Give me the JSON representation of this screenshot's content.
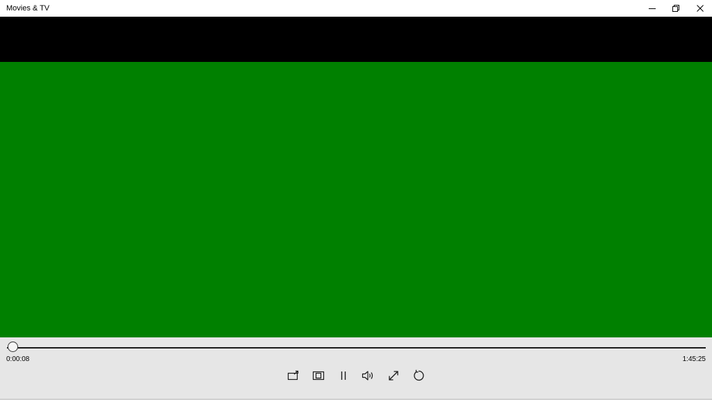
{
  "window": {
    "title": "Movies & TV",
    "buttons": {
      "minimize_icon": "minimize-icon",
      "restore_icon": "restore-icon",
      "close_icon": "close-icon"
    }
  },
  "player": {
    "letterbox_color": "#000000",
    "video_color": "#008000",
    "state": "playing",
    "progress_fraction": 0.0013,
    "time_elapsed": "0:00:08",
    "time_total": "1:45:25",
    "controls": [
      {
        "name": "cast-to-device",
        "icon": "cast-icon"
      },
      {
        "name": "aspect-ratio",
        "icon": "aspect-ratio-icon"
      },
      {
        "name": "pause",
        "icon": "pause-icon"
      },
      {
        "name": "volume",
        "icon": "volume-icon"
      },
      {
        "name": "full-screen",
        "icon": "expand-icon"
      },
      {
        "name": "repeat",
        "icon": "repeat-icon"
      }
    ]
  }
}
